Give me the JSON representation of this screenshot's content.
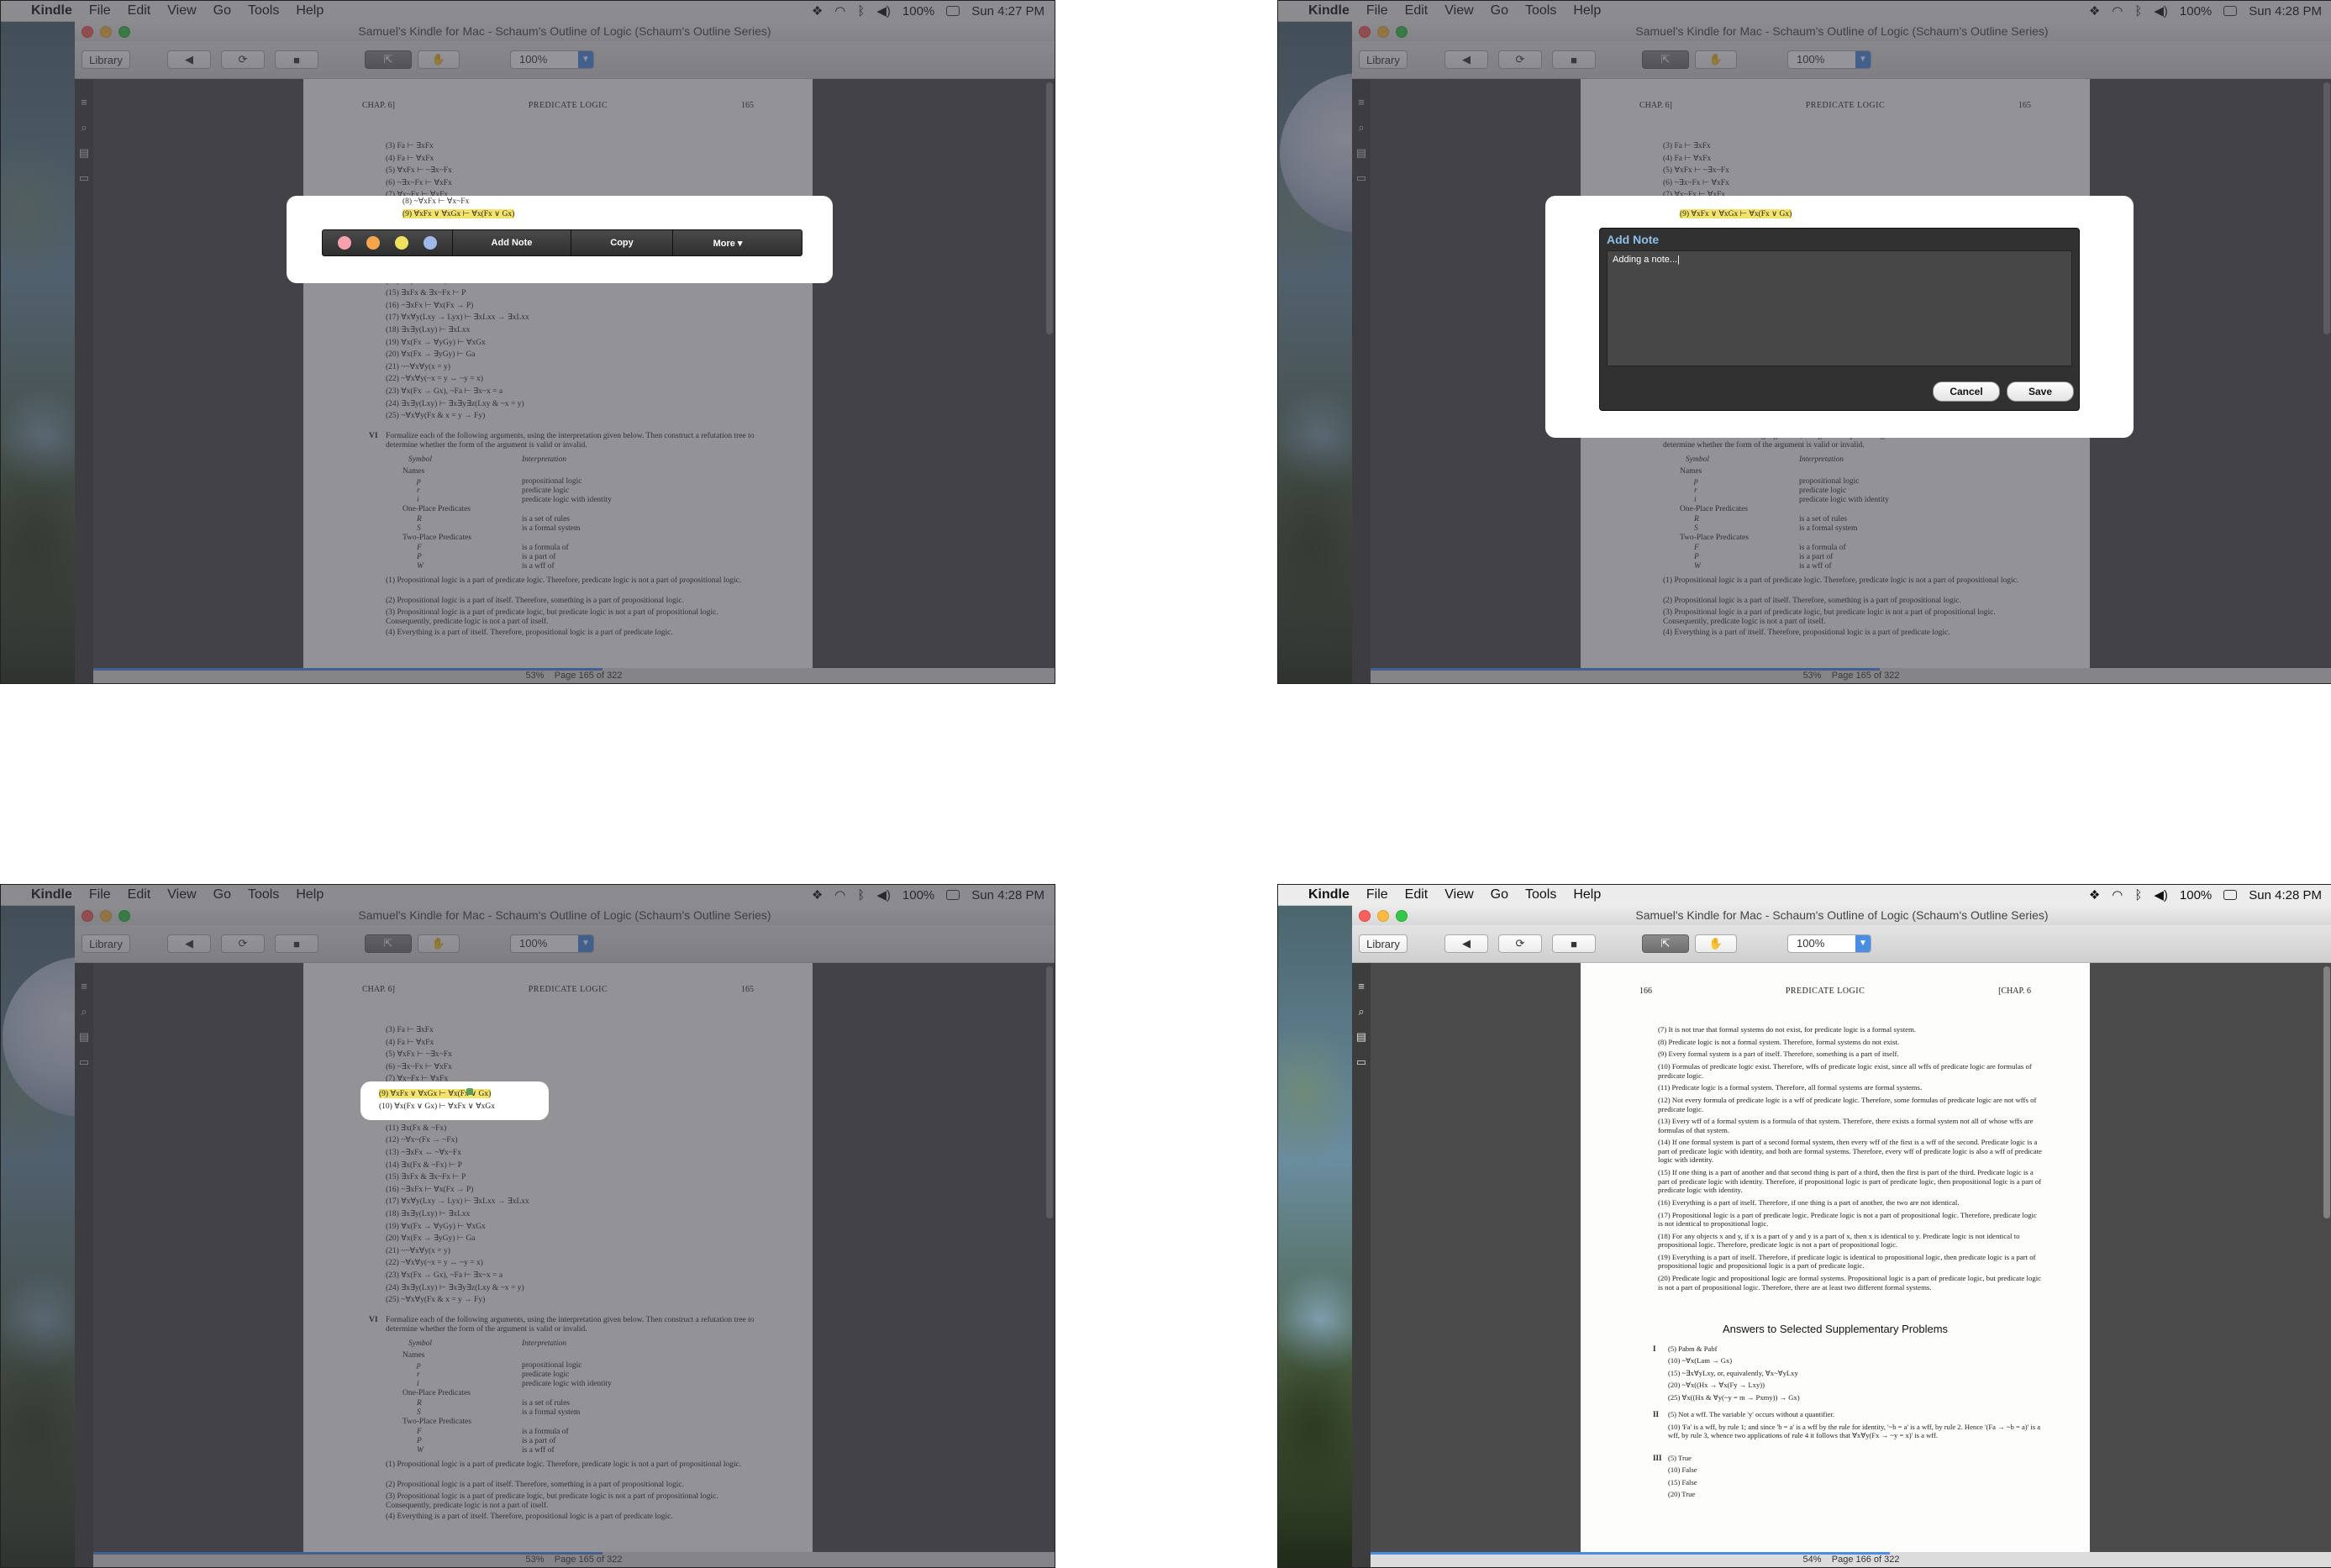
{
  "app": {
    "menu_app": "Kindle",
    "menus": [
      "File",
      "Edit",
      "View",
      "Go",
      "Tools",
      "Help"
    ],
    "battery": "100%",
    "window_title": "Samuel's Kindle for Mac - Schaum's Outline of Logic (Schaum's Outline Series)",
    "library_label": "Library",
    "zoom_value": "100%"
  },
  "panels": [
    {
      "clock": "Sun 4:27 PM",
      "status_pct": "53%",
      "status_page": "Page 165 of 322"
    },
    {
      "clock": "Sun 4:28 PM",
      "status_pct": "53%",
      "status_page": "Page 165 of 322"
    },
    {
      "clock": "Sun 4:28 PM",
      "status_pct": "53%",
      "status_page": "Page 165 of 322"
    },
    {
      "clock": "Sun 4:28 PM",
      "status_pct": "54%",
      "status_page": "Page 166 of 322"
    }
  ],
  "page165": {
    "header_left": "CHAP. 6]",
    "header_center": "PREDICATE LOGIC",
    "header_right": "165",
    "lines": [
      "(3)   Fa ⊢ ∃xFx",
      "(4)   Fa ⊢ ∀xFx",
      "(5)   ∀xFx ⊢ ~∃x~Fx",
      "(6)   ~∃x~Fx ⊢ ∀xFx",
      "(7)   ∀x~Fx ⊢ ∀xFx",
      "(8)   ~∀xFx ⊢ ∀x~Fx",
      "(9)   ∀xFx ∨ ∀xGx ⊢ ∀x(Fx ∨ Gx)",
      "(10)  ∀x(Fx ∨ Gx) ⊢ ∀xFx ∨ ∀xGx",
      "(11)  ∃x(Fx & ~Fx)",
      "(12)  ~∀x~(Fx → ~Fx)",
      "(13)  ~∃xFx ↔ ~∀x~Fx",
      "(14)  ∃x(Fx & ~Fx) ⊢ P",
      "(15)  ∃xFx & ∃x~Fx ⊢ P",
      "(16)  ~∃xFx ⊢ ∀x(Fx → P)",
      "(17)  ∀x∀y(Lxy → Lyx) ⊢ ∃xLxx → ∃xLxx",
      "(18)  ∃x∃y(Lxy) ⊢ ∃xLxx",
      "(19)  ∀x(Fx → ∀yGy) ⊢ ∀xGx",
      "(20)  ∀x(Fx → ∃yGy) ⊢ Ga",
      "(21)  ~~∀x∀y(x = y)",
      "(22)  ~∀x∀y(~x = y ↔ ~y = x)",
      "(23)  ∀x(Fx → Gx), ~Fa ⊢ ∃x~x = a",
      "(24)  ∃x∃y(Lxy) ⊢ ∃x∃y∃z(Lxy & ~x = y)",
      "(25)  ~∀x∀y(Fx & x = y → Fy)"
    ],
    "section_num": "VI",
    "section_text": "Formalize each of the following arguments, using the interpretation given below. Then construct a refutation tree to determine whether the form of the argument is valid or invalid.",
    "col_symbol": "Symbol",
    "col_interp": "Interpretation",
    "names_label": "Names",
    "sym_rows": [
      [
        "p",
        "propositional logic"
      ],
      [
        "r",
        "predicate logic"
      ],
      [
        "i",
        "predicate logic with identity"
      ]
    ],
    "one_place_label": "One-Place Predicates",
    "one_rows": [
      [
        "R",
        "is a set of rules"
      ],
      [
        "S",
        "is a formal system"
      ]
    ],
    "two_place_label": "Two-Place Predicates",
    "two_rows": [
      [
        "F",
        "is a formula of"
      ],
      [
        "P",
        "is a part of"
      ],
      [
        "W",
        "is a wff of"
      ]
    ],
    "args": [
      "(1)  Propositional logic is a part of predicate logic. Therefore, predicate logic is not a part of propositional logic.",
      "(2)  Propositional logic is a part of itself. Therefore, something is a part of propositional logic.",
      "(3)  Propositional logic is a part of predicate logic, but predicate logic is not a part of propositional logic. Consequently, predicate logic is not a part of itself.",
      "(4)  Everything is a part of itself. Therefore, propositional logic is a part of predicate logic."
    ]
  },
  "popup": {
    "add_note": "Add Note",
    "copy": "Copy",
    "more": "More ▾",
    "colors": [
      "#f6a1ad",
      "#f5a64d",
      "#f0e060",
      "#9fb8e8"
    ]
  },
  "note": {
    "header": "Add Note",
    "text": "Adding a note...|",
    "cancel": "Cancel",
    "save": "Save"
  },
  "page166": {
    "header_left": "166",
    "header_center": "PREDICATE LOGIC",
    "header_right": "[CHAP. 6",
    "items": [
      "(7)  It is not true that formal systems do not exist, for predicate logic is a formal system.",
      "(8)  Predicate logic is not a formal system. Therefore, formal systems do not exist.",
      "(9)  Every formal system is a part of itself. Therefore, something is a part of itself.",
      "(10)  Formulas of predicate logic exist. Therefore, wffs of predicate logic exist, since all wffs of predicate logic are formulas of predicate logic.",
      "(11)  Predicate logic is a formal system. Therefore, all formal systems are formal systems.",
      "(12)  Not every formula of predicate logic is a wff of predicate logic. Therefore, some formulas of predicate logic are not wffs of predicate logic.",
      "(13)  Every wff of a formal system is a formula of that system. Therefore, there exists a formal system not all of whose wffs are formulas of that system.",
      "(14)  If one formal system is part of a second formal system, then every wff of the first is a wff of the second. Predicate logic is a part of predicate logic with identity, and both are formal systems. Therefore, every wff of predicate logic is also a wff of predicate logic with identity.",
      "(15)  If one thing is a part of another and that second thing is part of a third, then the first is part of the third. Predicate logic is a part of predicate logic with identity. Therefore, if propositional logic is part of predicate logic, then propositional logic is a part of predicate logic with identity.",
      "(16)  Everything is a part of itself. Therefore, if one thing is a part of another, the two are not identical.",
      "(17)  Propositional logic is a part of predicate logic. Predicate logic is not a part of propositional logic. Therefore, predicate logic is not identical to propositional logic.",
      "(18)  For any objects x and y, if x is a part of y and y is a part of x, then x is identical to y. Predicate logic is not identical to propositional logic. Therefore, predicate logic is not a part of propositional logic.",
      "(19)  Everything is a part of itself. Therefore, if predicate logic is identical to propositional logic, then predicate logic is a part of propositional logic and propositional logic is a part of predicate logic.",
      "(20)  Predicate logic and propositional logic are formal systems. Propositional logic is a part of predicate logic, but predicate logic is not a part of propositional logic. Therefore, there are at least two different formal systems."
    ],
    "answers_title": "Answers to Selected Supplementary Problems",
    "ans_I": "I",
    "ans_I_rows": [
      "(5)   Pabm & Pabf",
      "(10)  ~∀x(Lam → Gx)",
      "(15)  ~∃x∀yLxy, or, equivalently, ∀x~∀yLxy",
      "(20)  ~∀x((Hx → ∀x(Fy → Lxy))",
      "(25)  ∀x((Hx & ∀y(~y = m → Pxmy)) → Gx)"
    ],
    "ans_II": "II",
    "ans_II_rows": [
      "(5)   Not a wff. The variable 'y' occurs without a quantifier.",
      "(10)  'Fa' is a wff, by rule 1; and since 'b = a' is a wff by the rule for identity, '~b = a' is a wff, by rule 2. Hence '(Fa → ~b = a)' is a wff, by rule 3, whence two applications of rule 4 it follows that ∀x∀y(Fx → ~y = x)' is a wff."
    ],
    "ans_III": "III",
    "ans_III_rows": [
      "(5)   True",
      "(10)  False",
      "(15)  False",
      "(20)  True"
    ]
  }
}
